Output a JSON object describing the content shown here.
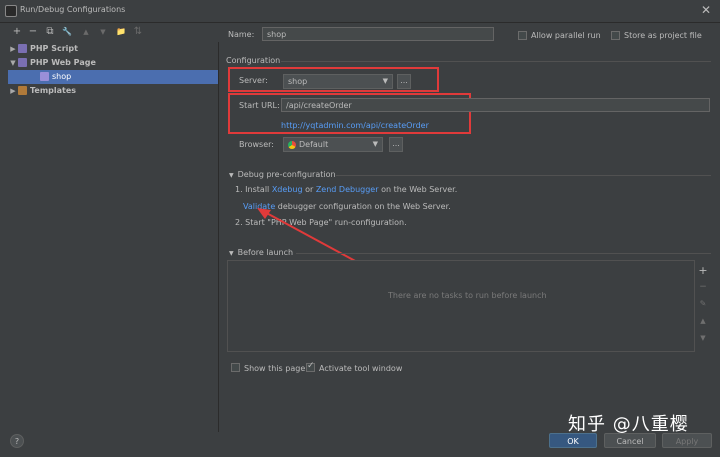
{
  "window": {
    "title": "Run/Debug Configurations",
    "close_glyph": "✕"
  },
  "toolbar": {
    "icons": [
      "+",
      "−",
      "⧉",
      "🔧",
      "▲",
      "▼",
      "📁",
      "⇅"
    ]
  },
  "tree": {
    "items": [
      {
        "label": "PHP Script",
        "expanded": false
      },
      {
        "label": "PHP Web Page",
        "expanded": true
      },
      {
        "label": "shop",
        "selected": true
      },
      {
        "label": "Templates",
        "expanded": false
      }
    ]
  },
  "form": {
    "name_label": "Name:",
    "name_value": "shop",
    "allow_parallel_label": "Allow parallel run",
    "store_project_label": "Store as project file",
    "configuration_label": "Configuration",
    "server_label": "Server:",
    "server_value": "shop",
    "start_url_label": "Start URL:",
    "start_url_value": "/api/createOrder",
    "full_url": "http://yqtadmin.com/api/createOrder",
    "browser_label": "Browser:",
    "browser_value": "Default",
    "dots": "..."
  },
  "debug": {
    "header": "Debug pre-configuration",
    "line1_prefix": "1. Install",
    "xdebug_link": "Xdebug",
    "or_text": "or",
    "zend_link": "Zend Debugger",
    "line1_suffix": "on the Web Server.",
    "validate_link": "Validate",
    "validate_suffix": "debugger configuration on the Web Server.",
    "line2": "2. Start \"PHP Web Page\" run-configuration."
  },
  "before_launch": {
    "header": "Before launch",
    "empty_text": "There are no tasks to run before launch"
  },
  "footer": {
    "show_page_label": "Show this page",
    "activate_tool_label": "Activate tool window",
    "ok_label": "OK",
    "cancel_label": "Cancel",
    "apply_label": "Apply",
    "help_glyph": "?"
  },
  "watermark": "知乎 @八重樱",
  "colors": {
    "accent": "#4b6eaf",
    "link": "#589df6",
    "highlight": "#e03a3a"
  }
}
